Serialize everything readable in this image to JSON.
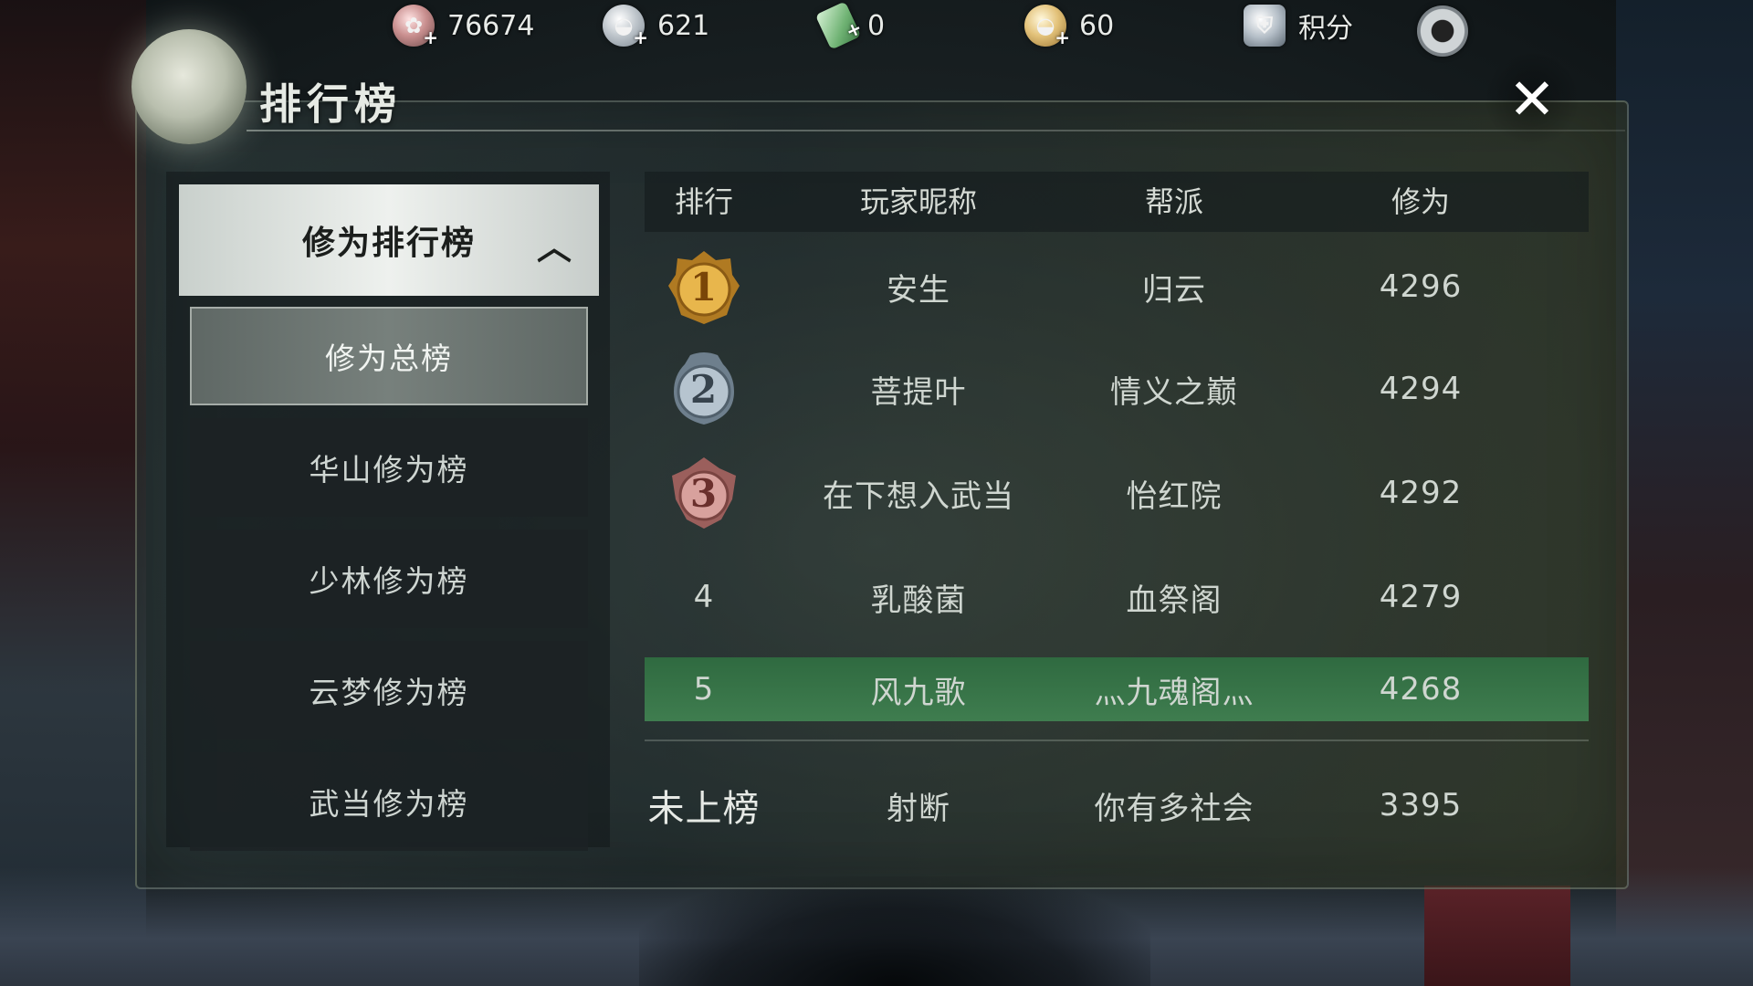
{
  "resources": [
    {
      "icon": "coin-icon",
      "value": "76674"
    },
    {
      "icon": "silver-ingot-icon",
      "value": "621"
    },
    {
      "icon": "jade-ticket-icon",
      "value": "0"
    },
    {
      "icon": "gold-ingot-icon",
      "value": "60"
    },
    {
      "icon": "points-badge-icon",
      "value": "积分"
    }
  ],
  "window": {
    "title": "排行榜",
    "close_label": "✕"
  },
  "menu": {
    "header": "修为排行榜",
    "items": [
      {
        "label": "修为总榜",
        "active": true
      },
      {
        "label": "华山修为榜",
        "active": false
      },
      {
        "label": "少林修为榜",
        "active": false
      },
      {
        "label": "云梦修为榜",
        "active": false
      },
      {
        "label": "武当修为榜",
        "active": false
      }
    ]
  },
  "table": {
    "headers": [
      "排行",
      "玩家昵称",
      "帮派",
      "修为"
    ],
    "rows": [
      {
        "rank": "1",
        "name": "安生",
        "guild": "归云",
        "score": "4296"
      },
      {
        "rank": "2",
        "name": "菩提叶",
        "guild": "情义之巅",
        "score": "4294"
      },
      {
        "rank": "3",
        "name": "在下想入武当",
        "guild": "怡红院",
        "score": "4292"
      },
      {
        "rank": "4",
        "name": "乳酸菌",
        "guild": "血祭阁",
        "score": "4279"
      },
      {
        "rank": "5",
        "name": "风九歌",
        "guild": "灬九魂阁灬",
        "score": "4268"
      }
    ],
    "self": {
      "rank": "未上榜",
      "name": "射断",
      "guild": "你有多社会",
      "score": "3395"
    }
  },
  "colors": {
    "medal_gold": "#d9a441",
    "medal_silver": "#9fb0bf",
    "medal_bronze": "#c98a86",
    "self_row": "#3a7649"
  }
}
